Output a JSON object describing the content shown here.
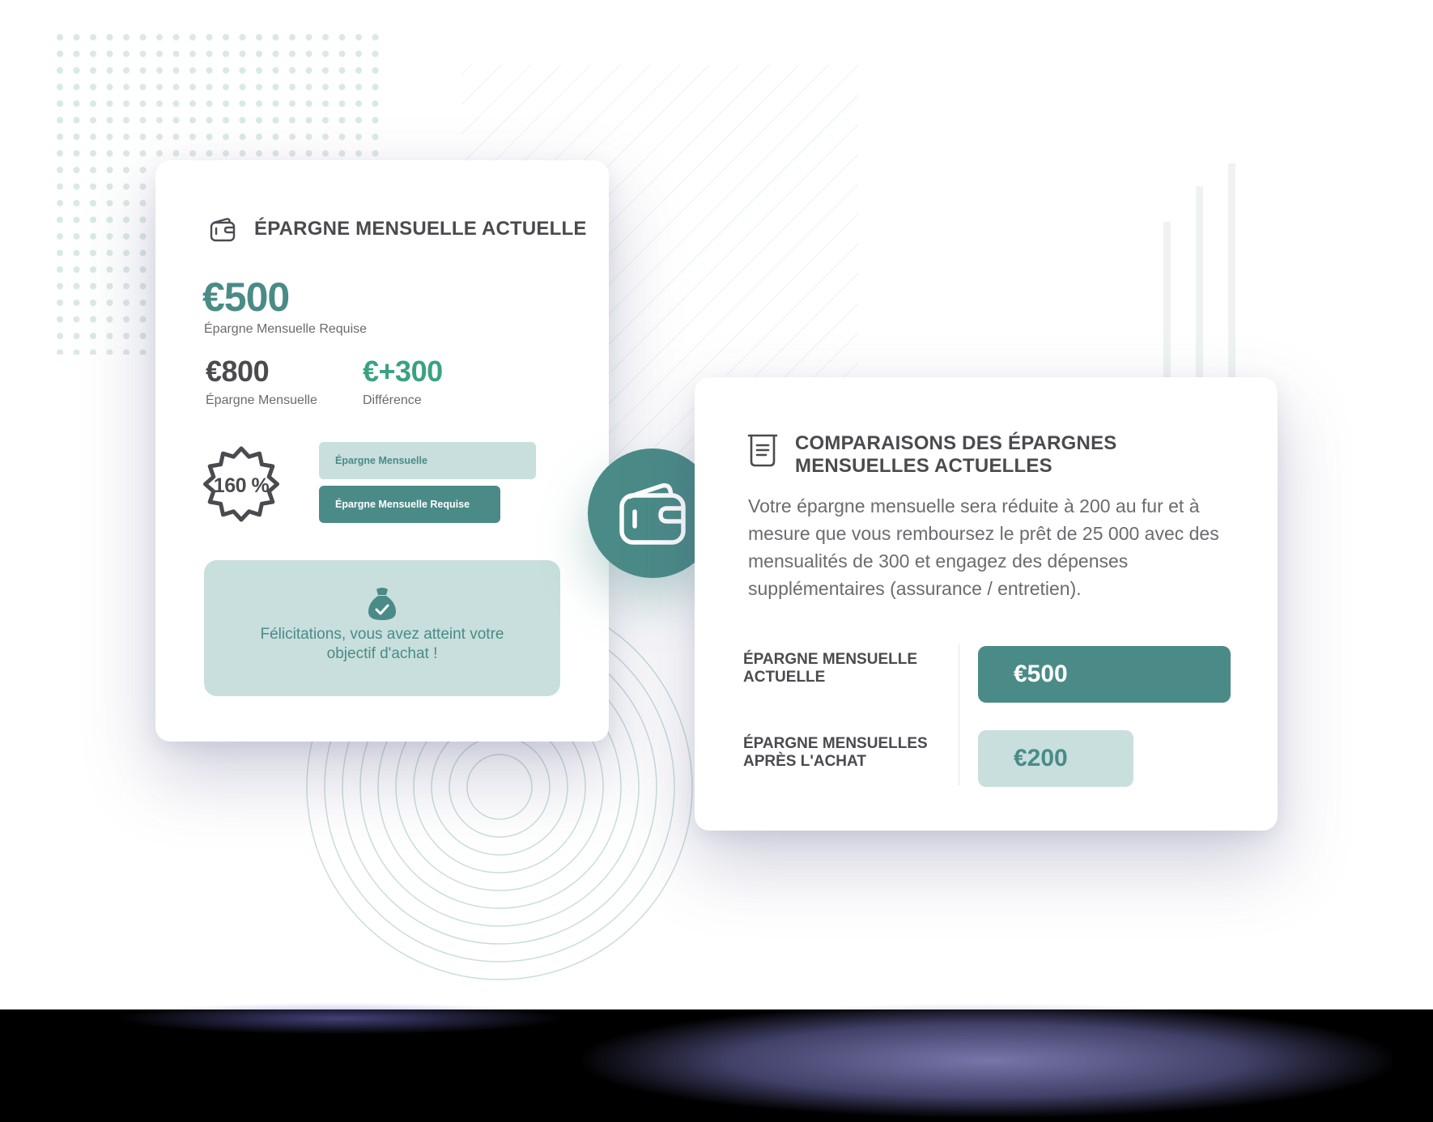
{
  "colors": {
    "primary": "#4a8b87",
    "primary_light": "#c8dfdd",
    "positive": "#3aa283",
    "heading": "#4a4a4f",
    "muted": "#6b6b70"
  },
  "current_savings_card": {
    "icon": "wallet-icon",
    "title": "ÉPARGNE MENSUELLE ACTUELLE",
    "required_amount": "€500",
    "required_caption": "Épargne Mensuelle Requise",
    "monthly_amount": "€800",
    "monthly_caption": "Épargne Mensuelle",
    "difference_amount": "€+300",
    "difference_caption": "Différence",
    "badge_value": "160 %",
    "bar_monthly_label": "Épargne Mensuelle",
    "bar_required_label": "Épargne Mensuelle Requise",
    "success_icon": "money-bag-check-icon",
    "success_message": "Félicitations, vous avez atteint votre objectif d'achat !"
  },
  "hub_icon": "wallet-icon",
  "comparison_card": {
    "icon": "list-box-icon",
    "title_line_1": "COMPARAISONS DES ÉPARGNES",
    "title_line_2": "MENSUELLES ACTUELLES",
    "description": "Votre épargne mensuelle sera réduite à 200 au fur et à mesure que vous remboursez le prêt de 25 000 avec des mensualités de 300 et engagez des dépenses supplémentaires (assurance / entretien).",
    "rows": [
      {
        "label": "ÉPARGNE MENSUELLE ACTUELLE",
        "value": "€500"
      },
      {
        "label": "ÉPARGNE MENSUELLES APRÈS L'ACHAT",
        "value": "€200"
      }
    ]
  }
}
